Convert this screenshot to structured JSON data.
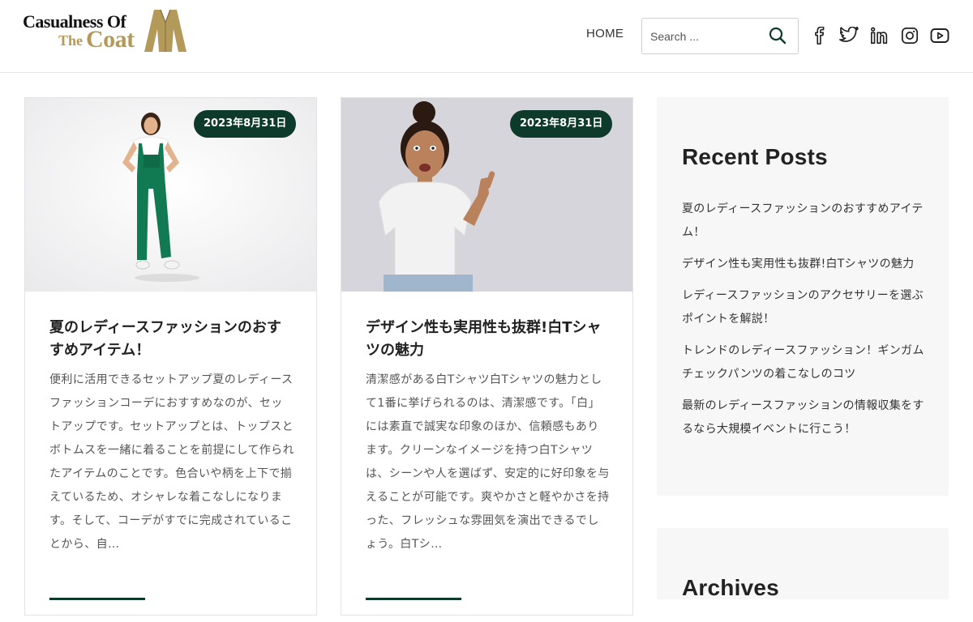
{
  "brand": {
    "logo_line1": "Casualness Of",
    "logo_line2a": "The",
    "logo_line2b": "Coat",
    "accent_color": "#b49a5a",
    "primary_color": "#0e3a2c"
  },
  "nav": {
    "home_label": "HOME"
  },
  "search": {
    "placeholder": "Search ...",
    "icon": "search-icon"
  },
  "social_icons": [
    "facebook-icon",
    "twitter-icon",
    "linkedin-icon",
    "instagram-icon",
    "youtube-icon"
  ],
  "posts": [
    {
      "date": "2023年8月31日",
      "title": "夏のレディースファッションのおすすめアイテム！",
      "excerpt": "便利に活用できるセットアップ夏のレディースファッションコーデにおすすめなのが、セットアップです。セットアップとは、トップスとボトムスを一緒に着ることを前提にして作られたアイテムのことです。色合いや柄を上下で揃えているため、オシャレな着こなしになります。そして、コーデがすでに完成されていることから、自…"
    },
    {
      "date": "2023年8月31日",
      "title": "デザイン性も実用性も抜群!白Tシャツの魅力",
      "excerpt": "清潔感がある白Tシャツ白Tシャツの魅力として1番に挙げられるのは、清潔感です。「白」には素直で誠実な印象のほか、信頼感もあります。クリーンなイメージを持つ白Tシャツは、シーンや人を選ばず、安定的に好印象を与えることが可能です。爽やかさと軽やかさを持った、フレッシュな雰囲気を演出できるでしょう。白Tシ…"
    }
  ],
  "sidebar": {
    "recent_title": "Recent Posts",
    "recent_posts": [
      "夏のレディースファッションのおすすめアイテム！",
      "デザイン性も実用性も抜群!白Tシャツの魅力",
      "レディースファッションのアクセサリーを選ぶポイントを解説！",
      "トレンドのレディースファッション！ギンガムチェックパンツの着こなしのコツ",
      "最新のレディースファッションの情報収集をするなら大規模イベントに行こう！"
    ],
    "archives_title": "Archives"
  }
}
